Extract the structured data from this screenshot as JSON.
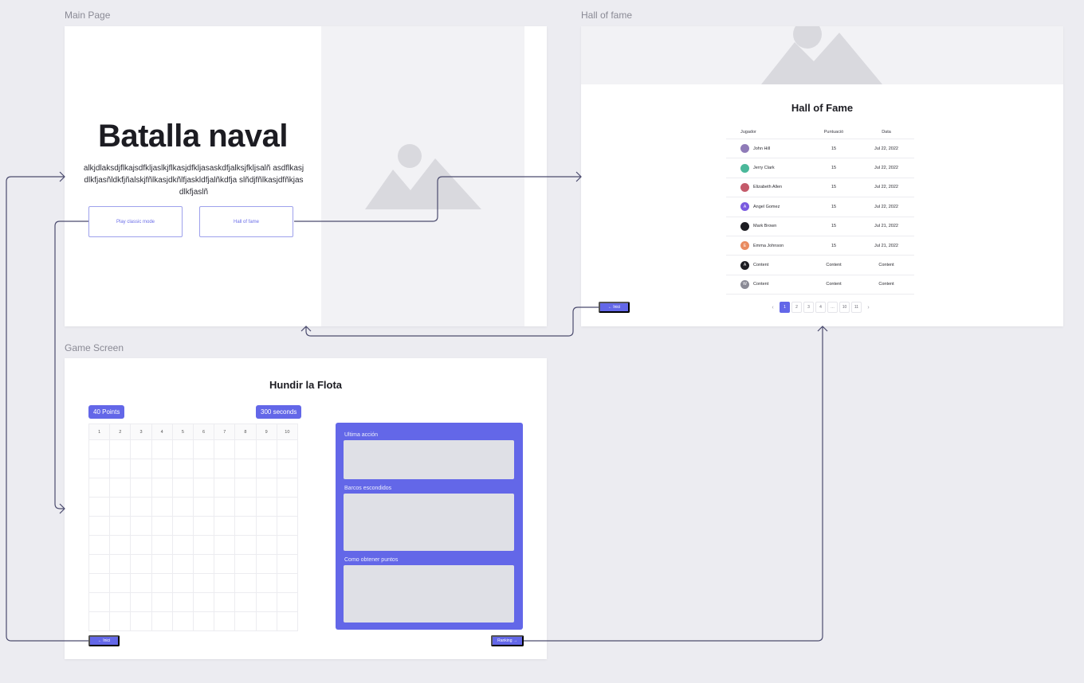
{
  "frames": {
    "main": {
      "label": "Main Page"
    },
    "hall": {
      "label": "Hall of fame"
    },
    "game": {
      "label": "Game Screen"
    }
  },
  "main": {
    "title": "Batalla naval",
    "description": "alkjdlaksdjflkajsdfkljaslkjflkasjdfkljasaskdfjalksjfkljsalñ asdflkasjdlkfjasñldkfjñalskjfñlkasjdkñlfjaskldfjalñkdfja slñdjfñlkasjdfñkjasdlkfjaslñ",
    "play_button": "Play classic mode",
    "hof_button": "Hall of fame"
  },
  "hall": {
    "title": "Hall of Fame",
    "headers": [
      "Jugador",
      "Puntuació",
      "Data"
    ],
    "rows": [
      {
        "name": "John Hill",
        "score": "15",
        "date": "Jul 22, 2022",
        "avatar": "photo"
      },
      {
        "name": "Jerry Clark",
        "score": "15",
        "date": "Jul 22, 2022",
        "avatar": "photo"
      },
      {
        "name": "Elizabeth Allen",
        "score": "15",
        "date": "Jul 22, 2022",
        "avatar": "photo"
      },
      {
        "name": "Angel Gomez",
        "score": "15",
        "date": "Jul 22, 2022",
        "avatar": "A"
      },
      {
        "name": "Mark Brown",
        "score": "15",
        "date": "Jul 21, 2022",
        "avatar": "photo"
      },
      {
        "name": "Emma Johnson",
        "score": "15",
        "date": "Jul 21, 2022",
        "avatar": "E"
      },
      {
        "name": "Content",
        "score": "Content",
        "date": "Content",
        "avatar": "A"
      },
      {
        "name": "Content",
        "score": "Content",
        "date": "Content",
        "avatar": "W"
      }
    ],
    "avatar_colors": [
      "#8f7bb8",
      "#4bb89a",
      "#c45a6a",
      "#7a5be0",
      "#1c1c22",
      "#e98b60",
      "#1c1c22",
      "#8a8a95"
    ],
    "pagination": [
      "1",
      "2",
      "3",
      "4",
      "…",
      "10",
      "11"
    ],
    "inici_button": "← Inici"
  },
  "game": {
    "title": "Hundir la Flota",
    "points": "40 Points",
    "seconds": "300 seconds",
    "columns": [
      "1",
      "2",
      "3",
      "4",
      "5",
      "6",
      "7",
      "8",
      "9",
      "10"
    ],
    "panel": {
      "last_action": "Ultima acción",
      "hidden_ships": "Barcos escondidos",
      "how_points": "Como obtener puntos"
    },
    "inici_button": "← Inici",
    "ranking_button": "Ranking →"
  },
  "colors": {
    "accent": "#6367e8",
    "connector": "#4b4b6e"
  }
}
